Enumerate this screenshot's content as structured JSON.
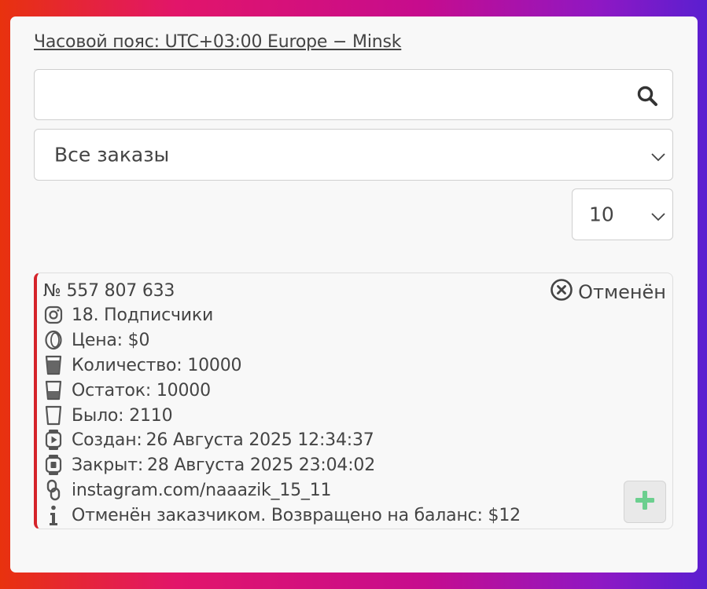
{
  "timezone_link": "Часовой пояс: UTC+03:00 Europe − Minsk",
  "search": {
    "value": "",
    "placeholder": ""
  },
  "status_filter": {
    "selected": "Все заказы"
  },
  "page_size": {
    "selected": "10"
  },
  "order": {
    "number": "№ 557 807 633",
    "status": "Отменён",
    "service": "18. Подписчики",
    "price": "Цена: $0",
    "quantity": "Количество: 10000",
    "remains": "Остаток: 10000",
    "start_count": "Было: 2110",
    "created_label": "Создан:",
    "created_value": "26 Августа 2025 12:34:37",
    "closed_label": "Закрыт:",
    "closed_value": "28 Августа 2025 23:04:02",
    "link": "instagram.com/naaazik_15_11",
    "note": "Отменён заказчиком. Возвращено на баланс: $12"
  },
  "colors": {
    "cancel_accent": "#d5232a",
    "add_icon": "#6ccf8f"
  },
  "icons": [
    "search-icon",
    "chevron-down-icon",
    "cancel-circle-icon",
    "instagram-icon",
    "coin-icon",
    "cup-full-icon",
    "cup-half-icon",
    "cup-empty-icon",
    "watch-play-icon",
    "watch-stop-icon",
    "link-icon",
    "info-icon",
    "plus-icon"
  ]
}
